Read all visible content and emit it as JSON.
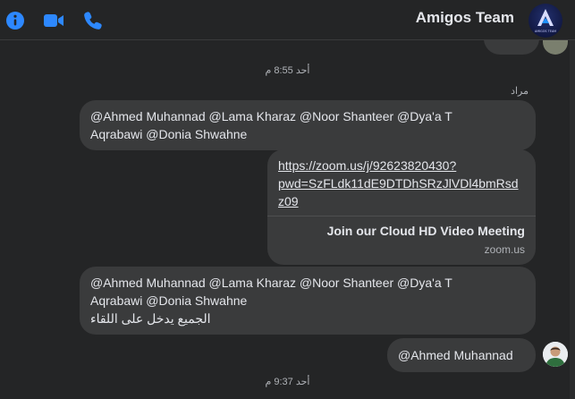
{
  "header": {
    "title": "Amigos Team",
    "avatar_text": "AMIGOS TEAM",
    "icons": [
      "info-icon",
      "video-call-icon",
      "phone-call-icon"
    ],
    "accent_color": "#2d88ff"
  },
  "chat": {
    "timestamps": [
      "أحد 8:55 م",
      "أحد 9:37 م"
    ],
    "sender_name": "مراد",
    "messages": [
      {
        "type": "text",
        "lines": [
          "@Ahmed Muhannad @Lama Kharaz @Noor Shanteer @Dya'a T",
          "Aqrabawi @Donia Shwahne"
        ]
      },
      {
        "type": "link",
        "url_lines": [
          "https://zoom.us/j/92623820430?",
          "pwd=SzFLdk11dE9DTDhSRzJlVDl4bmRsd",
          "z09"
        ],
        "title": "Join our Cloud HD Video Meeting",
        "domain": "zoom.us"
      },
      {
        "type": "text",
        "lines": [
          "@Ahmed Muhannad @Lama Kharaz @Noor Shanteer @Dya'a T",
          "Aqrabawi @Donia Shwahne",
          "الجميع يدخل على اللقاء"
        ]
      },
      {
        "type": "text",
        "lines": [
          "@Ahmed Muhannad"
        ]
      }
    ]
  }
}
